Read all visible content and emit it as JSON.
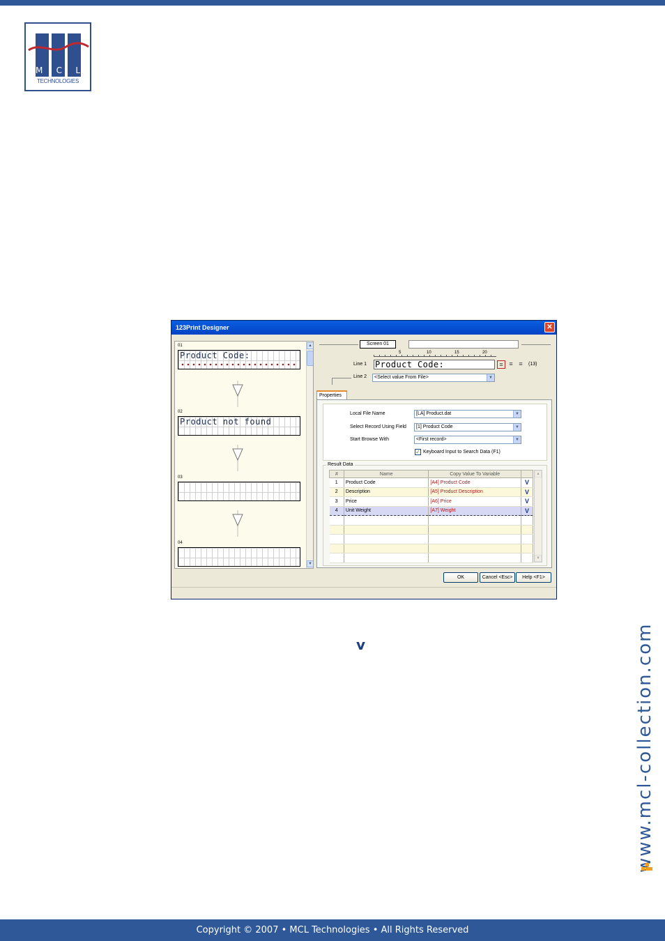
{
  "brand": {
    "logo_letters": [
      "M",
      "C",
      "L"
    ],
    "logo_subtitle": "TECHNOLOGIES",
    "website": "www.mcl-collection.com",
    "accent_color": "#2f5899"
  },
  "footer": {
    "copyright": "Copyright © 2007 • MCL Technologies • All Rights Reserved"
  },
  "dialog": {
    "title": "123Print Designer",
    "close_icon": "close-icon",
    "flow": {
      "screens": [
        {
          "number": "01",
          "text": "Product Code:"
        },
        {
          "number": "02",
          "text": "Product not found"
        },
        {
          "number": "03",
          "text": ""
        },
        {
          "number": "04",
          "text": ""
        }
      ]
    },
    "screen_label": "Screen 01",
    "ruler_marks": [
      "5",
      "10",
      "15",
      "20"
    ],
    "line1_label": "Line 1",
    "line1_value": "Product Code:",
    "line1_count": "(13)",
    "line2_label": "Line 2",
    "line2_value": "<Select value From File>",
    "tab_label": "Properties",
    "properties": {
      "local_file_label": "Local File Name",
      "local_file_value": "[LA] Product.dat",
      "select_record_label": "Select Record Using Field",
      "select_record_value": "[1] Product Code",
      "start_browse_label": "Start Browse With",
      "start_browse_value": "<First record>",
      "keyboard_input_label": "Keyboard Input to Search Data (F1)",
      "keyboard_input_checked": true
    },
    "result_data": {
      "title": "Result Data",
      "columns": [
        "#",
        "Name",
        "Copy Value To Variable",
        ""
      ],
      "rows": [
        {
          "num": "1",
          "name": "Product Code",
          "variable": "[A4] Product Code",
          "flag": "V"
        },
        {
          "num": "2",
          "name": "Description",
          "variable": "[A5] Product Description",
          "flag": "V"
        },
        {
          "num": "3",
          "name": "Price",
          "variable": "[A6] Price",
          "flag": "V"
        },
        {
          "num": "4",
          "name": "Unit Weight",
          "variable": "[A7] Weight",
          "flag": "V"
        }
      ],
      "selected_row": 4
    },
    "buttons": {
      "ok": "OK",
      "cancel": "Cancel <Esc>",
      "help": "Help <F1>"
    }
  },
  "below_caption_glyph": "v"
}
